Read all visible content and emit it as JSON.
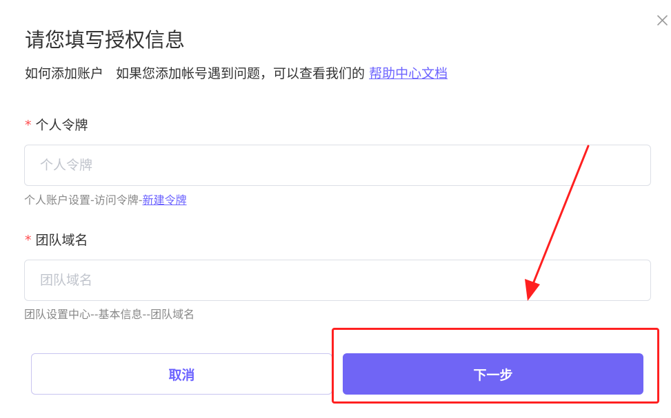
{
  "dialog": {
    "title": "请您填写授权信息",
    "intro_label": "如何添加账户",
    "intro_text": "如果您添加帐号遇到问题，可以查看我们的",
    "intro_link": "帮助中心文档"
  },
  "fields": {
    "token": {
      "required_mark": "*",
      "label": "个人令牌",
      "placeholder": "个人令牌",
      "help_text": "个人账户设置-访问令牌-",
      "help_link": "新建令牌"
    },
    "domain": {
      "required_mark": "*",
      "label": "团队域名",
      "placeholder": "团队域名",
      "help_text": "团队设置中心--基本信息--团队域名"
    }
  },
  "buttons": {
    "cancel": "取消",
    "next": "下一步"
  },
  "colors": {
    "accent": "#7065f5",
    "link": "#6c63ff",
    "required": "#ff4d4f",
    "annotation": "#ff2020"
  },
  "icons": {
    "close": "close-icon"
  }
}
